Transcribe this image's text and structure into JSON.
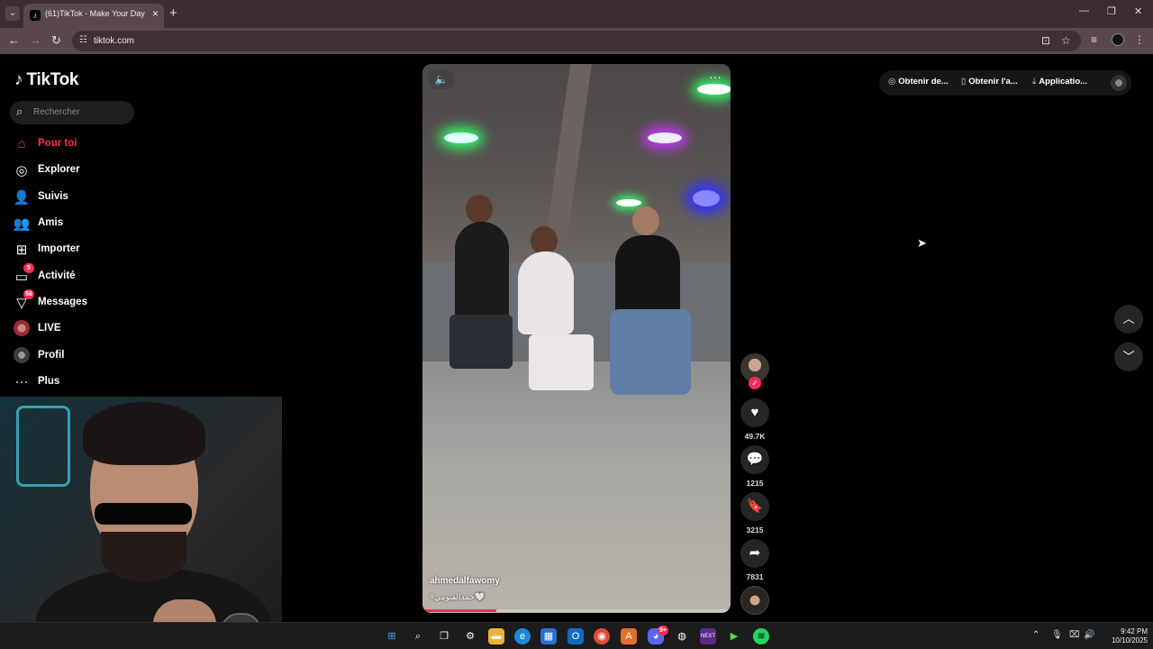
{
  "browser": {
    "tab_title": "(61)TikTok - Make Your Day",
    "url": "tiktok.com"
  },
  "tiktok": {
    "logo_text": "TikTok",
    "search_placeholder": "Rechercher",
    "nav": [
      {
        "label": "Pour toi",
        "icon": "home-icon",
        "active": true
      },
      {
        "label": "Explorer",
        "icon": "compass-icon"
      },
      {
        "label": "Suivis",
        "icon": "following-icon"
      },
      {
        "label": "Amis",
        "icon": "friends-icon"
      },
      {
        "label": "Importer",
        "icon": "upload-icon"
      },
      {
        "label": "Activité",
        "icon": "activity-icon",
        "badge": "5"
      },
      {
        "label": "Messages",
        "icon": "messages-icon",
        "badge": "56"
      },
      {
        "label": "LIVE",
        "icon": "live-icon"
      },
      {
        "label": "Profil",
        "icon": "profile-avatar"
      },
      {
        "label": "Plus",
        "icon": "more-icon"
      }
    ],
    "header": {
      "get_coins": "Obtenir de...",
      "get_app": "Obtenir l'a...",
      "application": "Applicatio..."
    },
    "video": {
      "author": "ahmedalfawomy",
      "caption": "#حمدالفيومي🤍",
      "progress": 0.24
    },
    "actions": {
      "likes": "49.7K",
      "comments": "1215",
      "saves": "3215",
      "shares": "7831"
    }
  },
  "taskbar": {
    "time": "9:42 PM",
    "date": "10/10/2025",
    "discord_badge": "9+"
  },
  "colors": {
    "accent": "#fe2c55",
    "browser_frame": "#3b2e32",
    "toolbar": "#5a4850"
  }
}
